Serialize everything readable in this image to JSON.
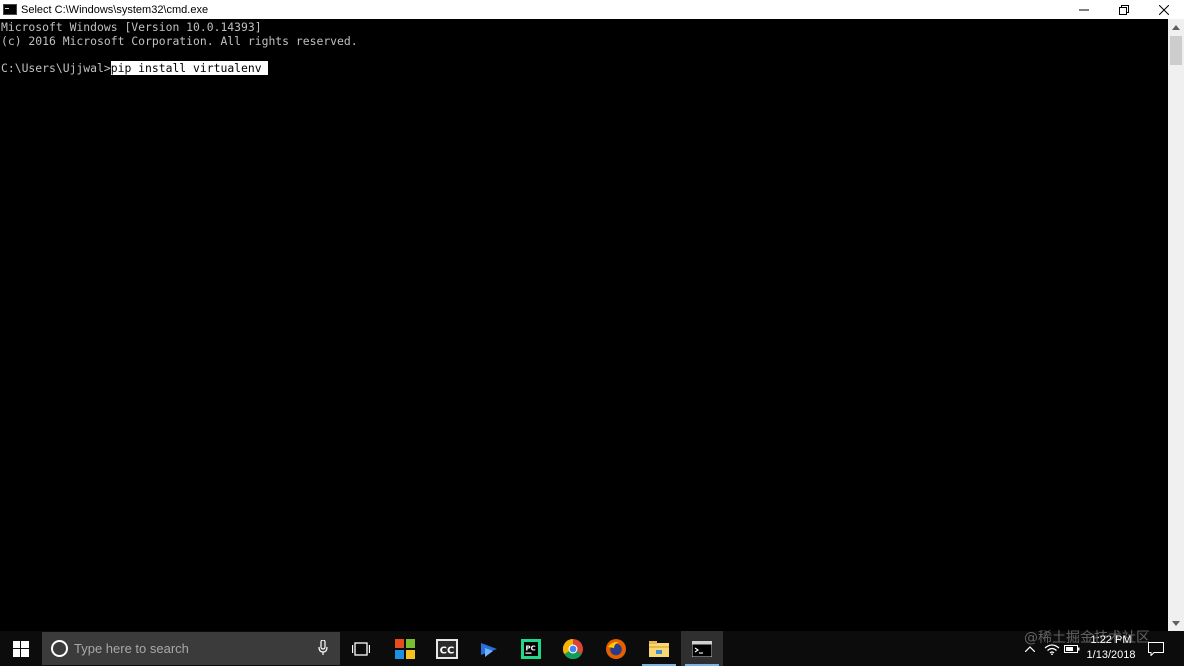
{
  "window": {
    "title": "Select C:\\Windows\\system32\\cmd.exe",
    "icon": "cmd-icon",
    "controls": [
      "minimize-icon",
      "restore-icon",
      "close-icon"
    ]
  },
  "console": {
    "lines": [
      "Microsoft Windows [Version 10.0.14393]",
      "(c) 2016 Microsoft Corporation. All rights reserved."
    ],
    "prompt": "C:\\Users\\Ujjwal>",
    "command": "pip install virtualenv ",
    "text_color": "#c0c0c0",
    "background": "#000000"
  },
  "taskbar": {
    "search_placeholder": "Type here to search",
    "apps": [
      "task-view-icon",
      "app-store-icon",
      "cc-icon",
      "network-app-icon",
      "pycharm-icon",
      "chrome-icon",
      "firefox-icon",
      "file-explorer-icon",
      "cmd-taskbar-icon"
    ],
    "active_app": "cmd-taskbar-icon",
    "cc_label": "CC",
    "pycharm_label": "PC"
  },
  "clock": {
    "time": "1:22 PM",
    "date": "1/13/2018"
  },
  "watermark": "@稀土掘金技术社区"
}
